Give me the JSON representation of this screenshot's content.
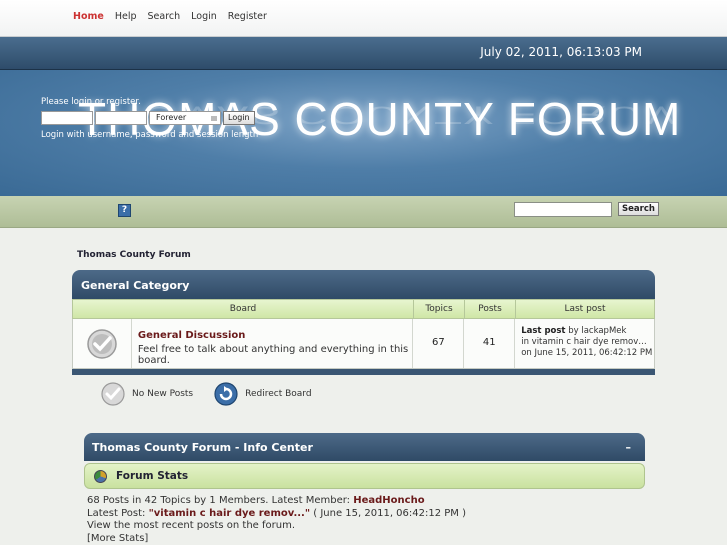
{
  "nav": {
    "items": [
      "Home",
      "Help",
      "Search",
      "Login",
      "Register"
    ],
    "active": "Home"
  },
  "datetime": "July 02, 2011, 06:13:03 PM",
  "banner": {
    "logo_text": "THOMAS COUNTY FORUM"
  },
  "login": {
    "hint": "Please login or register.",
    "session_option": "Forever",
    "login_button": "Login",
    "sub_hint": "Login with username, password and session length"
  },
  "toolbar": {
    "help_icon": "?",
    "search_button": "Search",
    "search_value": ""
  },
  "breadcrumb": "Thomas County Forum",
  "category": {
    "title": "General Category",
    "columns": {
      "board": "Board",
      "topics": "Topics",
      "posts": "Posts",
      "lastpost": "Last post"
    },
    "boards": [
      {
        "name": "General Discussion",
        "description": "Feel free to talk about anything and everything in this board.",
        "topics": "67",
        "posts": "41",
        "lastpost_label": "Last post",
        "lastpost_by": "by lackapMek",
        "lastpost_in": "in vitamin c hair dye remov…",
        "lastpost_on": "on June 15, 2011, 06:42:12 PM"
      }
    ]
  },
  "legend": {
    "no_new": "No New Posts",
    "redirect": "Redirect Board"
  },
  "info_center": {
    "title": "Thomas County Forum - Info Center",
    "collapse": "–",
    "stats_title": "Forum Stats",
    "stats_line_prefix": "68 Posts in 42 Topics by 1 Members. Latest Member: ",
    "latest_member": "HeadHoncho",
    "latest_post_prefix": "Latest Post: ",
    "latest_post_title": "\"vitamin c hair dye remov...\"",
    "latest_post_date": " ( June 15, 2011, 06:42:12 PM )",
    "recent_link": "View the most recent posts on the forum.",
    "more_stats": "[More Stats]"
  },
  "colors": {
    "accent_red": "#cc3333",
    "header_blue": "#2f4a66",
    "green_bar": "#c9e19f"
  }
}
